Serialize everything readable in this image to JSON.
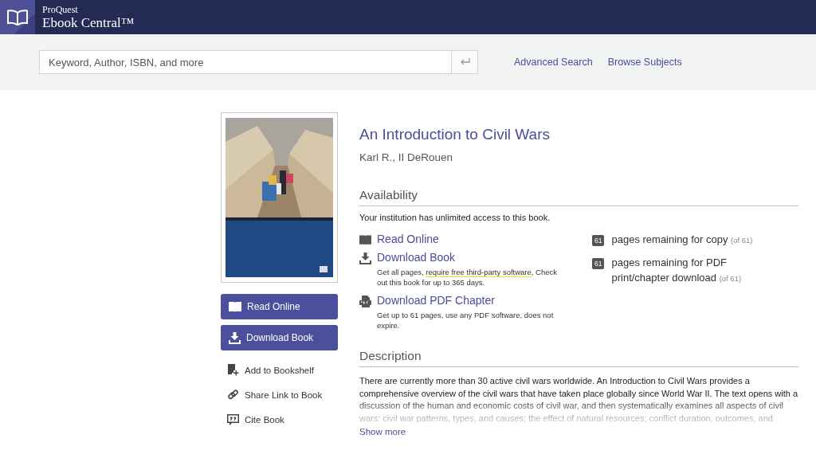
{
  "header": {
    "brand_small": "ProQuest",
    "brand": "Ebook Central™"
  },
  "search": {
    "placeholder": "Keyword, Author, ISBN, and more",
    "links": [
      "Advanced Search",
      "Browse Subjects"
    ]
  },
  "sidebar": {
    "buttons": [
      {
        "kind": "read",
        "label": "Read Online"
      },
      {
        "kind": "download",
        "label": "Download Book"
      }
    ],
    "actions": [
      {
        "kind": "bookshelf",
        "label": "Add to Bookshelf"
      },
      {
        "kind": "link",
        "label": "Share Link to Book"
      },
      {
        "kind": "cite",
        "label": "Cite Book"
      }
    ]
  },
  "book": {
    "title": "An Introduction to Civil Wars",
    "author": "Karl R., II DeRouen",
    "availability": {
      "heading": "Availability",
      "note": "Your institution has unlimited access to this book.",
      "options": [
        {
          "kind": "read",
          "label": "Read Online"
        },
        {
          "kind": "download",
          "label": "Download Book",
          "description": [
            {
              "text": "Get all pages, ",
              "highlighted": false
            },
            {
              "text": "require free third-party software",
              "highlighted": true
            },
            {
              "text": ", Check out this book for up to 365 days.",
              "highlighted": false
            }
          ]
        },
        {
          "kind": "pdf",
          "label": "Download PDF Chapter",
          "description": [
            {
              "text": "Get up to 61 pages, use any PDF software, does not expire.",
              "highlighted": false
            }
          ]
        }
      ],
      "quotas": [
        {
          "count": "61",
          "label": "pages remaining for copy",
          "total": "(of 61)"
        },
        {
          "count": "61",
          "label": "pages remaining for PDF print/chapter download",
          "total": "(of 61)"
        }
      ]
    },
    "description": {
      "heading": "Description",
      "text": "There are currently more than 30 active civil wars worldwide. An Introduction to Civil Wars provides a comprehensive overview of the civil wars that have taken place globally since World War II. The text opens with a discussion of the human and economic costs of civil war, and then systematically examines all aspects of civil wars: civil war patterns, types, and causes; the effect of natural resources; conflict duration, outcomes, and",
      "more": "Show more"
    }
  }
}
